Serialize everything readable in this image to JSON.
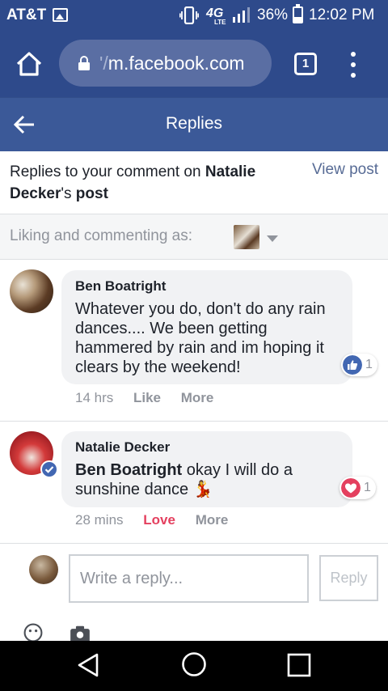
{
  "status_bar": {
    "carrier": "AT&T",
    "network": "4G",
    "network_sub": "LTE",
    "battery": "36%",
    "battery_level": 0.36,
    "time": "12:02 PM",
    "icons": [
      "image-icon",
      "vibrate-icon",
      "signal-icon",
      "battery-icon"
    ]
  },
  "browser": {
    "url_prefix": "'/",
    "url": "m.facebook.com",
    "tab_count": "1",
    "icons": [
      "home-icon",
      "lock-icon",
      "tabs-icon",
      "menu-dots-icon"
    ]
  },
  "header": {
    "title": "Replies",
    "back_icon": "back-arrow-icon"
  },
  "info": {
    "prefix": "Replies to your comment on ",
    "name": "Natalie Decker",
    "possessive": "'s ",
    "post": "post",
    "view_post": "View post"
  },
  "liking": {
    "label": "Liking and commenting as:"
  },
  "comments": [
    {
      "author": "Ben Boatright",
      "text": "Whatever you do, don't do any rain dances.... We been getting hammered by rain and im hoping it clears by the weekend!",
      "reaction": "like",
      "reaction_count": "1",
      "time": "14 hrs",
      "action_label": "Like",
      "more_label": "More"
    },
    {
      "author": "Natalie Decker",
      "verified": true,
      "mention": "Ben Boatright",
      "text": " okay I will do a sunshine dance",
      "emoji": "💃",
      "reaction": "love",
      "reaction_count": "1",
      "time": "28 mins",
      "action_label": "Love",
      "more_label": "More"
    }
  ],
  "composer": {
    "placeholder": "Write a reply...",
    "reply_label": "Reply"
  },
  "colors": {
    "status_bar": "#2e4a8b",
    "fb_blue": "#3b5998",
    "like_blue": "#4267b2",
    "love_red": "#e4405f",
    "muted": "#90949c"
  }
}
